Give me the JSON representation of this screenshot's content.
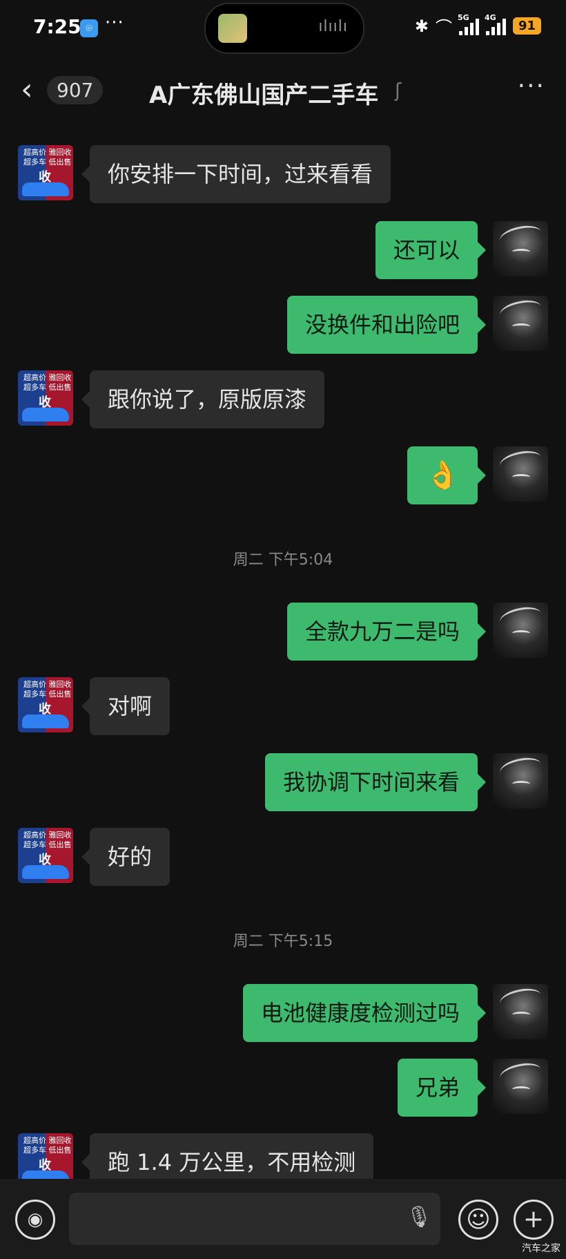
{
  "status_bar": {
    "time": "7:25",
    "app_badge": "⌾",
    "more": "···",
    "icons": [
      "bluetooth-icon",
      "earbuds-icon",
      "signal-5g-icon",
      "signal-4g-icon"
    ],
    "bluetooth_glyph": "✱",
    "earbuds_glyph": "⌒",
    "sig1_label": "5G",
    "sig2_label": "4G",
    "battery": "91",
    "battery_color": "#f5a623"
  },
  "header": {
    "back_glyph": "‹",
    "unread_count": "907",
    "title": "A广东佛山国产二手车",
    "ear_glyph": "ʃ",
    "menu_glyph": "···"
  },
  "avatars": {
    "left_text": "超高价 雅回收\n超多车 低出售",
    "left_mark": "收"
  },
  "messages": [
    {
      "side": "left",
      "text": "你安排一下时间，过来看看"
    },
    {
      "side": "right",
      "text": "还可以"
    },
    {
      "side": "right",
      "text": "没换件和出险吧"
    },
    {
      "side": "left",
      "text": "跟你说了，原版原漆"
    },
    {
      "side": "right",
      "text": "👌"
    },
    {
      "type": "time",
      "text": "周二 下午5:04"
    },
    {
      "side": "right",
      "text": "全款九万二是吗"
    },
    {
      "side": "left",
      "text": "对啊"
    },
    {
      "side": "right",
      "text": "我协调下时间来看"
    },
    {
      "side": "left",
      "text": "好的"
    },
    {
      "type": "time",
      "text": "周二 下午5:15"
    },
    {
      "side": "right",
      "text": "电池健康度检测过吗"
    },
    {
      "side": "right",
      "text": "兄弟"
    },
    {
      "side": "left",
      "text": "跑 1.4 万公里，不用检测"
    }
  ],
  "input_bar": {
    "voice_glyph": "◉",
    "mic_glyph": "🎙",
    "emoji_glyph": "☺",
    "plus_glyph": "+"
  },
  "watermark": "汽车之家",
  "colors": {
    "background": "#111111",
    "bubble_left": "#2c2c2c",
    "bubble_right": "#3dba6e",
    "accent_blue": "#3a9bf0"
  }
}
